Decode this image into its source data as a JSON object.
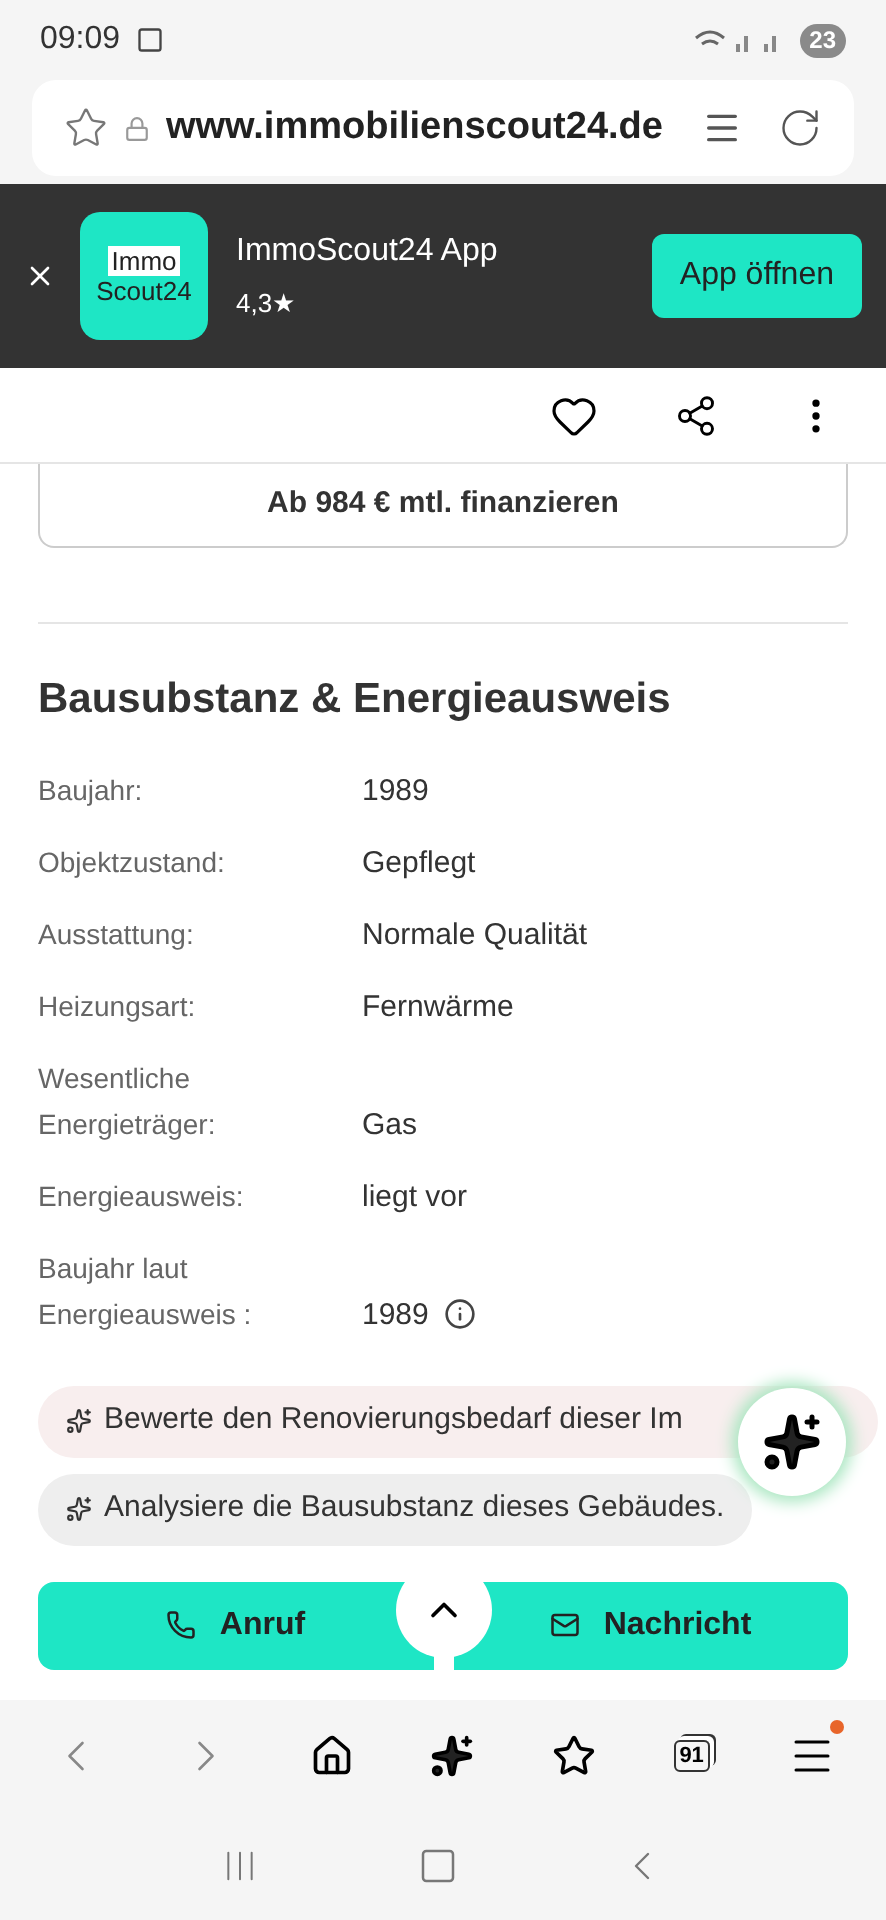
{
  "status_bar": {
    "time": "09:09",
    "battery": "23"
  },
  "browser": {
    "url": "www.immobilienscout24.de",
    "tab_count": "91",
    "menu_badge": true
  },
  "app_banner": {
    "logo_line1": "Immo",
    "logo_line2": "Scout24",
    "title": "ImmoScout24 App",
    "rating": "4,3★",
    "button": "App öffnen"
  },
  "finance_button": "Ab 984 € mtl. finanzieren",
  "section": {
    "title": "Bausubstanz & Energieausweis",
    "rows": [
      {
        "label": "Baujahr:",
        "value": "1989",
        "info": false
      },
      {
        "label": "Objektzustand:",
        "value": "Gepflegt",
        "info": false
      },
      {
        "label": "Ausstattung:",
        "value": "Normale Qualität",
        "info": false
      },
      {
        "label": "Heizungsart:",
        "value": "Fernwärme",
        "info": false
      },
      {
        "label": "Wesentliche Energieträger:",
        "value": "Gas",
        "info": false
      },
      {
        "label": "Energieausweis:",
        "value": "liegt vor",
        "info": false
      },
      {
        "label": "Baujahr laut Energieausweis :",
        "value": "1989",
        "info": true
      }
    ]
  },
  "ai_chips": [
    {
      "text": "Bewerte den Renovierungsbedarf dieser Im",
      "color": "#f8eeee"
    },
    {
      "text": "Analysiere die Bausubstanz dieses Gebäudes.",
      "color": "#eeeeee"
    }
  ],
  "actions": [
    {
      "kind": "call",
      "label": "Anruf"
    },
    {
      "kind": "message",
      "label": "Nachricht"
    }
  ]
}
